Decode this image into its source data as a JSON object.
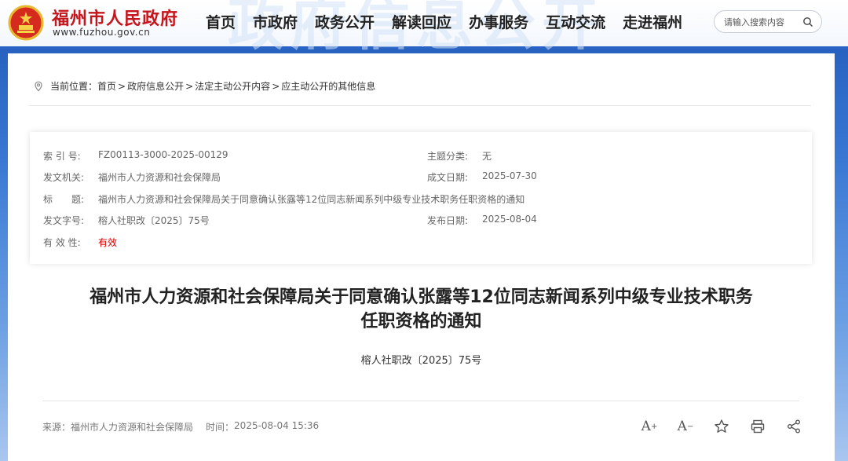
{
  "header": {
    "site_title": "福州市人民政府",
    "site_url": "www.fuzhou.gov.cn",
    "watermark": "政府信息公开",
    "nav": [
      "首页",
      "市政府",
      "政务公开",
      "解读回应",
      "办事服务",
      "互动交流",
      "走进福州"
    ],
    "search": {
      "placeholder": "请输入搜索内容"
    }
  },
  "breadcrumb": {
    "prefix": "当前位置：",
    "items": [
      "首页",
      "政府信息公开",
      "法定主动公开内容",
      "应主动公开的其他信息"
    ],
    "separator": ">"
  },
  "meta": {
    "index_label": "索 引 号:",
    "index_value": "FZ00113-3000-2025-00129",
    "topic_label": "主题分类:",
    "topic_value": "无",
    "issuer_label": "发文机关:",
    "issuer_value": "福州市人力资源和社会保障局",
    "date_written_label": "成文日期:",
    "date_written_value": "2025-07-30",
    "title_label": "标　　题:",
    "title_value": "福州市人力资源和社会保障局关于同意确认张露等12位同志新闻系列中级专业技术职务任职资格的通知",
    "doc_no_label": "发文字号:",
    "doc_no_value": "榕人社职改〔2025〕75号",
    "publish_label": "发布日期:",
    "publish_value": "2025-08-04",
    "validity_label": "有 效 性:",
    "validity_value": "有效"
  },
  "document": {
    "title_line1": "福州市人力资源和社会保障局关于同意确认张露等12位同志新闻系列中级专业技术职务",
    "title_line2": "任职资格的通知",
    "number": "榕人社职改〔2025〕75号"
  },
  "footer": {
    "source_label": "来源：",
    "source_value": "福州市人力资源和社会保障局",
    "time_label": "时间：",
    "time_value": "2025-08-04 15:36",
    "font_increase": "A",
    "font_decrease": "A"
  },
  "colors": {
    "brand_red": "#c4161c",
    "validity_red": "#d40000",
    "banner_blue": "#2a64c5"
  }
}
